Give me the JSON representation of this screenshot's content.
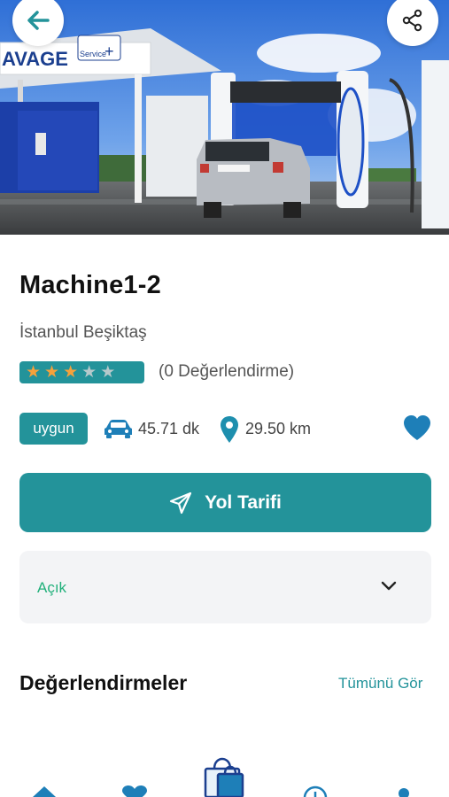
{
  "hero": {
    "sign_text": "AVAGE",
    "logo_text": "Service"
  },
  "header": {
    "back_icon": "back-arrow-icon",
    "share_icon": "share-icon"
  },
  "station": {
    "name": "Machine1-2",
    "location": "İstanbul Beşiktaş",
    "rating_stars": 3,
    "rating_max": 5,
    "rating_count_text": "(0 Değerlendirme)",
    "availability": "uygun",
    "drive_time": "45.71 dk",
    "distance": "29.50 km",
    "favorited": true
  },
  "actions": {
    "directions_label": "Yol Tarifi"
  },
  "hours": {
    "status": "Açık"
  },
  "reviews": {
    "title": "Değerlendirmeler",
    "see_all": "Tümünü Gör"
  },
  "bottom_nav": {
    "items": [
      "home-icon",
      "heart-icon",
      "shopping-bag-icon",
      "clock-icon",
      "profile-icon"
    ]
  },
  "colors": {
    "primary": "#23939a",
    "star_on": "#f6a13b",
    "status_open": "#20b07a",
    "heart": "#1e7fb8"
  }
}
